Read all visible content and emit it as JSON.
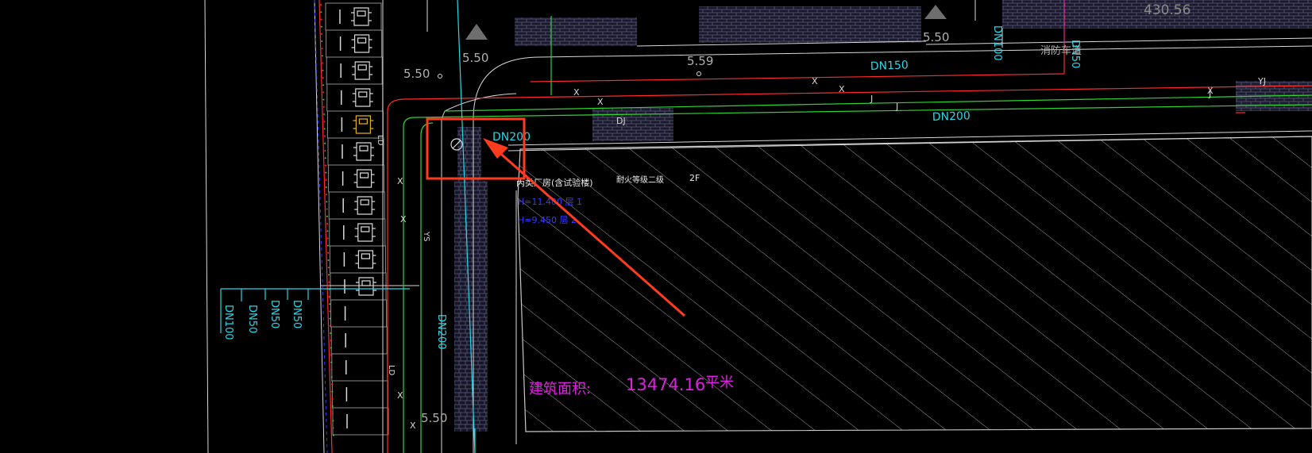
{
  "drawing": {
    "background": "#000000",
    "colors": {
      "white": "#d8d8d8",
      "red": "#ff2a2a",
      "green": "#2fd42f",
      "cyan": "#29d6e8",
      "magenta": "#e020e0",
      "blue": "#3a3aff",
      "gray": "#8c8c8c",
      "hatch": "#9a9a9a",
      "paving": "#55557a",
      "highlight": "#ff3b1e"
    },
    "elevations": [
      "5.50",
      "5.59",
      "5.50",
      "5.50",
      "5.50",
      "430.56"
    ],
    "pipe_labels": {
      "dn200_top": "DN200",
      "dn200_box": "DN200",
      "dn150_top": "DN150",
      "dn200_vertical": "DN200",
      "dn100_vertical": "DN100",
      "dn100_side": "DN100",
      "dn50_a": "DN50",
      "dn50_b": "DN50",
      "dn50_c": "DN50",
      "dn50_side": "DN50"
    },
    "line_codes": {
      "x": "X",
      "j": "J",
      "dj": "DJ",
      "yj": "YJ",
      "ld": "LD",
      "ys": "YS"
    },
    "fire_truck_label": "消防车道",
    "building": {
      "name": "丙类厂房(含试验楼)",
      "fire_rating": "耐火等级二级",
      "floors": "2F",
      "note_1": "H=11.400 层 1",
      "note_2": "H=9.450 层 2",
      "area_label": "建筑面积:",
      "area_value": "13474.16",
      "area_unit": "平米"
    },
    "annotation": {
      "box_color": "#ff3b1e",
      "arrow_color": "#ff3b1e"
    }
  }
}
